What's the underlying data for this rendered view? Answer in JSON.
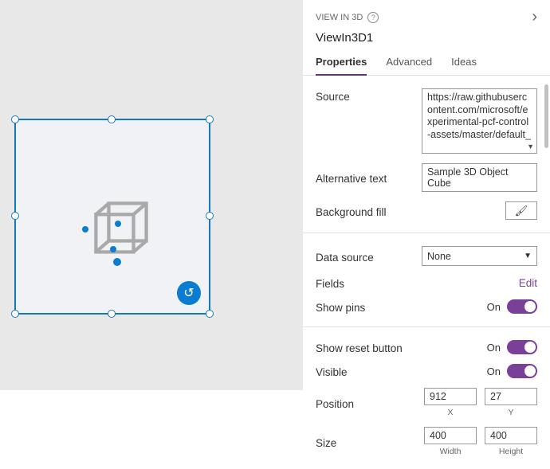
{
  "canvas": {
    "reset_icon": "↺"
  },
  "panel": {
    "crumb_label": "VIEW IN 3D",
    "help_glyph": "?",
    "chevron_glyph": "›",
    "control_name": "ViewIn3D1",
    "tabs": {
      "properties": "Properties",
      "advanced": "Advanced",
      "ideas": "Ideas"
    },
    "source": {
      "label": "Source",
      "value": "https://raw.githubusercontent.com/microsoft/experimental-pcf-control-assets/master/default_"
    },
    "alt_text": {
      "label": "Alternative text",
      "value": "Sample 3D Object Cube"
    },
    "bg_fill": {
      "label": "Background fill",
      "icon": "🖌"
    },
    "data_source": {
      "label": "Data source",
      "value": "None"
    },
    "fields": {
      "label": "Fields",
      "action": "Edit"
    },
    "show_pins": {
      "label": "Show pins",
      "state": "On"
    },
    "show_reset": {
      "label": "Show reset button",
      "state": "On"
    },
    "visible": {
      "label": "Visible",
      "state": "On"
    },
    "position": {
      "label": "Position",
      "x": "912",
      "y": "27",
      "x_label": "X",
      "y_label": "Y"
    },
    "size": {
      "label": "Size",
      "w": "400",
      "h": "400",
      "w_label": "Width",
      "h_label": "Height"
    }
  }
}
